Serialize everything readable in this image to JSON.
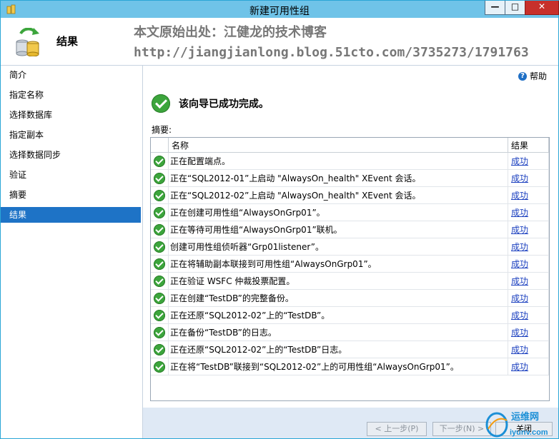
{
  "window": {
    "title": "新建可用性组",
    "controls": {
      "minimize": "—",
      "maximize": "□",
      "close": "✕"
    }
  },
  "header": {
    "title": "结果",
    "watermark_line1": "本文原始出处：江健龙的技术博客",
    "watermark_line2": "http://jiangjianlong.blog.51cto.com/3735273/1791763"
  },
  "sidebar": {
    "items": [
      "简介",
      "指定名称",
      "选择数据库",
      "指定副本",
      "选择数据同步",
      "验证",
      "摘要",
      "结果"
    ],
    "active_index": 7
  },
  "content": {
    "help_label": "帮助",
    "success_message": "该向导已成功完成。",
    "summary_label": "摘要:",
    "columns": {
      "name": "名称",
      "result": "结果"
    },
    "rows": [
      {
        "name": "正在配置端点。",
        "result": "成功"
      },
      {
        "name": "正在“SQL2012-01”上启动 \"AlwaysOn_health\" XEvent 会话。",
        "result": "成功"
      },
      {
        "name": "正在“SQL2012-02”上启动 \"AlwaysOn_health\" XEvent 会话。",
        "result": "成功"
      },
      {
        "name": "正在创建可用性组“AlwaysOnGrp01”。",
        "result": "成功"
      },
      {
        "name": "正在等待可用性组“AlwaysOnGrp01”联机。",
        "result": "成功"
      },
      {
        "name": "创建可用性组侦听器“Grp01listener”。",
        "result": "成功"
      },
      {
        "name": "正在将辅助副本联接到可用性组“AlwaysOnGrp01”。",
        "result": "成功"
      },
      {
        "name": "正在验证 WSFC 仲裁投票配置。",
        "result": "成功"
      },
      {
        "name": "正在创建“TestDB”的完整备份。",
        "result": "成功"
      },
      {
        "name": "正在还原“SQL2012-02”上的“TestDB”。",
        "result": "成功"
      },
      {
        "name": "正在备份“TestDB”的日志。",
        "result": "成功"
      },
      {
        "name": "正在还原“SQL2012-02”上的“TestDB”日志。",
        "result": "成功"
      },
      {
        "name": "正在将“TestDB”联接到“SQL2012-02”上的可用性组“AlwaysOnGrp01”。",
        "result": "成功"
      }
    ]
  },
  "footer": {
    "prev_label": "< 上一步(P)",
    "next_label": "下一步(N) >",
    "close_label": "关闭"
  },
  "logo_watermark": {
    "text": "运维网",
    "sub": "iyunv.com"
  }
}
